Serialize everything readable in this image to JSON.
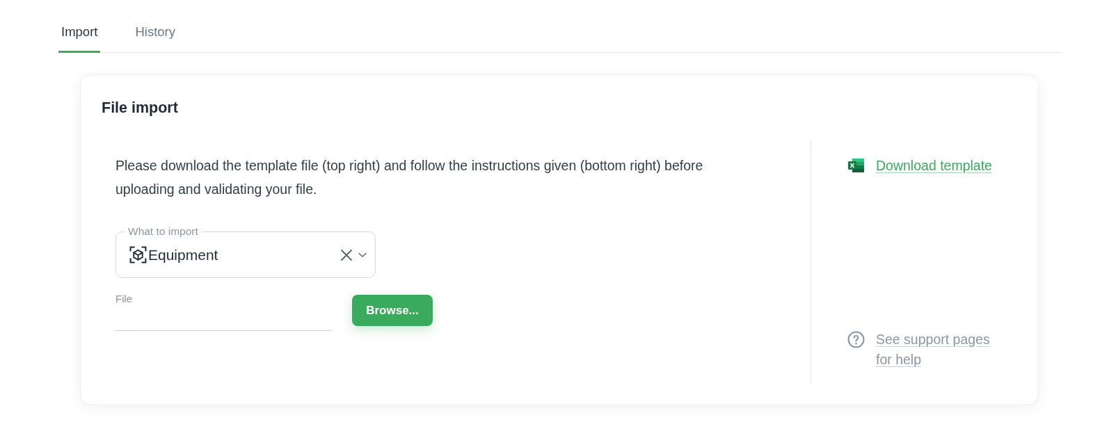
{
  "tabs": [
    {
      "label": "Import",
      "selected": true
    },
    {
      "label": "History",
      "selected": false
    }
  ],
  "card": {
    "title": "File import",
    "instructions": "Please download the template file (top right) and follow the instructions given (bottom right) before uploading and validating your file.",
    "select": {
      "label": "What to import",
      "value": "Equipment"
    },
    "file": {
      "label": "File"
    },
    "browse_button": "Browse...",
    "download_link": "Download template",
    "help_link": "See support pages for help"
  }
}
